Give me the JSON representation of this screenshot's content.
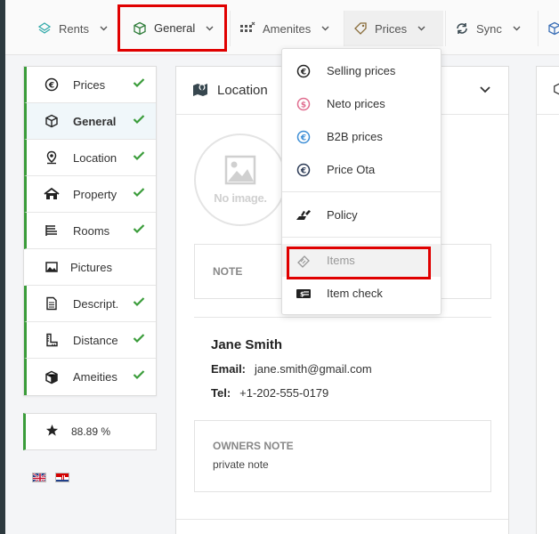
{
  "topnav": {
    "items": [
      {
        "label": "Rents",
        "icon": "rents-icon"
      },
      {
        "label": "General",
        "icon": "cube-icon"
      },
      {
        "label": "Amenites",
        "icon": "amenities-icon"
      },
      {
        "label": "Prices",
        "icon": "price-tag-icon"
      },
      {
        "label": "Sync",
        "icon": "sync-icon"
      }
    ]
  },
  "prices_menu": {
    "items": [
      {
        "label": "Selling prices",
        "icon": "euro-circle-icon"
      },
      {
        "label": "Neto prices",
        "icon": "dollar-circle-icon"
      },
      {
        "label": "B2B prices",
        "icon": "euro-circle-blue-icon"
      },
      {
        "label": "Price Ota",
        "icon": "euro-circle-dark-icon"
      },
      {
        "label": "Policy",
        "icon": "policy-icon"
      },
      {
        "label": "Items",
        "icon": "ticket-icon"
      },
      {
        "label": "Item check",
        "icon": "cash-icon"
      }
    ]
  },
  "sidebar": {
    "items": [
      {
        "label": "Prices",
        "icon": "euro-circle-icon",
        "done": true
      },
      {
        "label": "General",
        "icon": "cube-icon",
        "done": true
      },
      {
        "label": "Location",
        "icon": "map-pin-icon",
        "done": true
      },
      {
        "label": "Property",
        "icon": "home-icon",
        "done": true
      },
      {
        "label": "Rooms",
        "icon": "bed-icon",
        "done": true
      },
      {
        "label": "Pictures",
        "icon": "picture-icon",
        "done": false
      },
      {
        "label": "Descript.",
        "icon": "document-icon",
        "done": true
      },
      {
        "label": "Distance",
        "icon": "ruler-icon",
        "done": true
      },
      {
        "label": "Ameities",
        "icon": "box-icon",
        "done": true
      }
    ]
  },
  "score": {
    "value": "88.89 %"
  },
  "location_card": {
    "title": "Location",
    "no_image": "No image.",
    "note_label": "NOTE",
    "owner_name": "Jane Smith",
    "email_label": "Email:",
    "email": "jane.smith@gmail.com",
    "tel_label": "Tel:",
    "tel": "+1-202-555-0179",
    "owners_note_label": "OWNERS NOTE",
    "owners_note": "private note"
  },
  "colors": {
    "accent_green": "#3a9c3a",
    "highlight_red": "#e00000"
  }
}
